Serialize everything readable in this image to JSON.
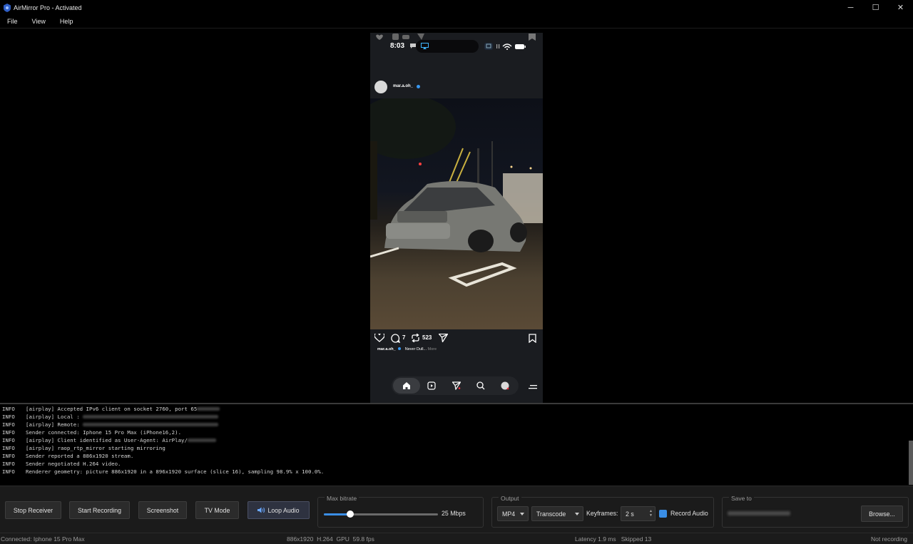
{
  "window": {
    "title": "AirMirror Pro - Activated",
    "controls": [
      "─",
      "☐",
      "✕"
    ]
  },
  "menu": [
    "File",
    "View",
    "Help"
  ],
  "phone": {
    "time": "8:03",
    "post": {
      "username": "mar.a.oh_",
      "comments": "7",
      "reposts": "523",
      "caption_user": "mar.a.oh_",
      "caption_text": "Never Dull...",
      "caption_more": "More"
    }
  },
  "log": [
    {
      "level": "INFO",
      "msg": "[airplay] Accepted IPv6 client on socket 2760, port 65",
      "redacted": true
    },
    {
      "level": "INFO",
      "msg": "[airplay] Local : ",
      "redacted": true
    },
    {
      "level": "INFO",
      "msg": "[airplay] Remote: ",
      "redacted": true
    },
    {
      "level": "INFO",
      "msg": "Sender connected: Iphone 15 Pro Max (iPhone16,2).",
      "redacted": false
    },
    {
      "level": "INFO",
      "msg": "[airplay] Client identified as User-Agent: AirPlay/",
      "redacted": true
    },
    {
      "level": "INFO",
      "msg": "[airplay] raop_rtp_mirror starting mirroring",
      "redacted": false
    },
    {
      "level": "INFO",
      "msg": "Sender reported a 886x1920 stream.",
      "redacted": false
    },
    {
      "level": "INFO",
      "msg": "Sender negotiated H.264 video.",
      "redacted": false
    },
    {
      "level": "INFO",
      "msg": "Renderer geometry: picture 886x1920 in a 896x1920 surface (slice 16), sampling 98.9% x 100.0%.",
      "redacted": false
    }
  ],
  "controls": {
    "stop_receiver": "Stop Receiver",
    "start_recording": "Start Recording",
    "screenshot": "Screenshot",
    "tv_mode": "TV Mode",
    "loop_audio": "Loop Audio",
    "max_bitrate_label": "Max bitrate",
    "max_bitrate_value": "25 Mbps",
    "max_bitrate_fraction": 0.23,
    "output_label": "Output",
    "format": "MP4",
    "mode": "Transcode",
    "keyframes_label": "Keyframes:",
    "keyframes_value": "2 s",
    "record_audio_label": "Record Audio",
    "record_audio_checked": true,
    "save_to_label": "Save to",
    "browse": "Browse..."
  },
  "status": {
    "connection": "Connected: Iphone 15 Pro Max",
    "stream": "886x1920  H.264  GPU  59.8 fps",
    "latency": "Latency 1.9 ms   Skipped 13",
    "recording": "Not recording"
  },
  "colors": {
    "accent": "#3a8ee6",
    "panel": "#1b1b1b",
    "background": "#000000"
  }
}
